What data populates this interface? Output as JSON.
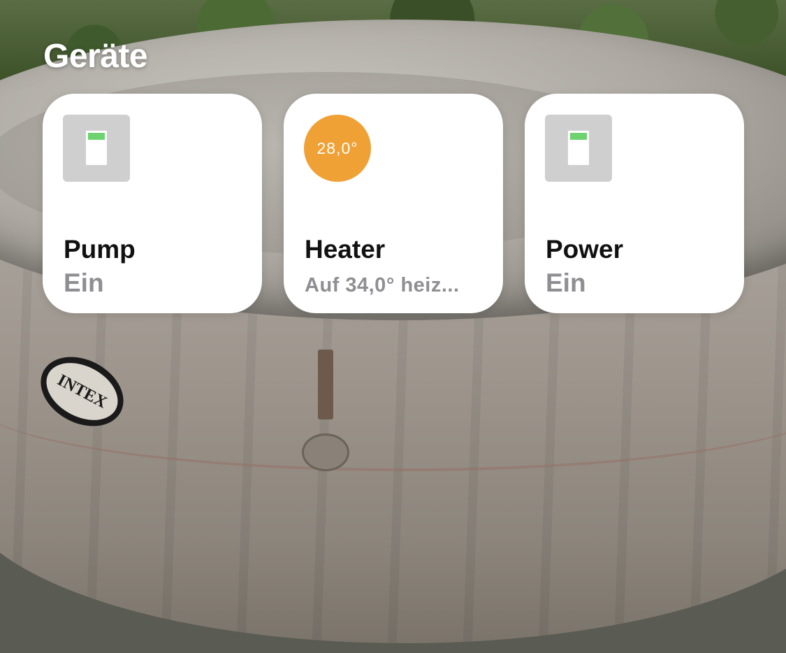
{
  "section": {
    "title": "Geräte"
  },
  "devices": [
    {
      "name": "Pump",
      "status": "Ein",
      "icon": "switch-icon",
      "state": "on"
    },
    {
      "name": "Heater",
      "status": "Auf 34,0° heiz...",
      "icon": "thermostat-icon",
      "current_temperature": "28,0°"
    },
    {
      "name": "Power",
      "status": "Ein",
      "icon": "switch-icon",
      "state": "on"
    }
  ],
  "colors": {
    "heating_accent": "#F0A135",
    "switch_on_indicator": "#6DD36F",
    "status_text": "#8E8E93",
    "tile_background": "#FFFFFF"
  },
  "background": {
    "logo_text": "INTEX"
  }
}
